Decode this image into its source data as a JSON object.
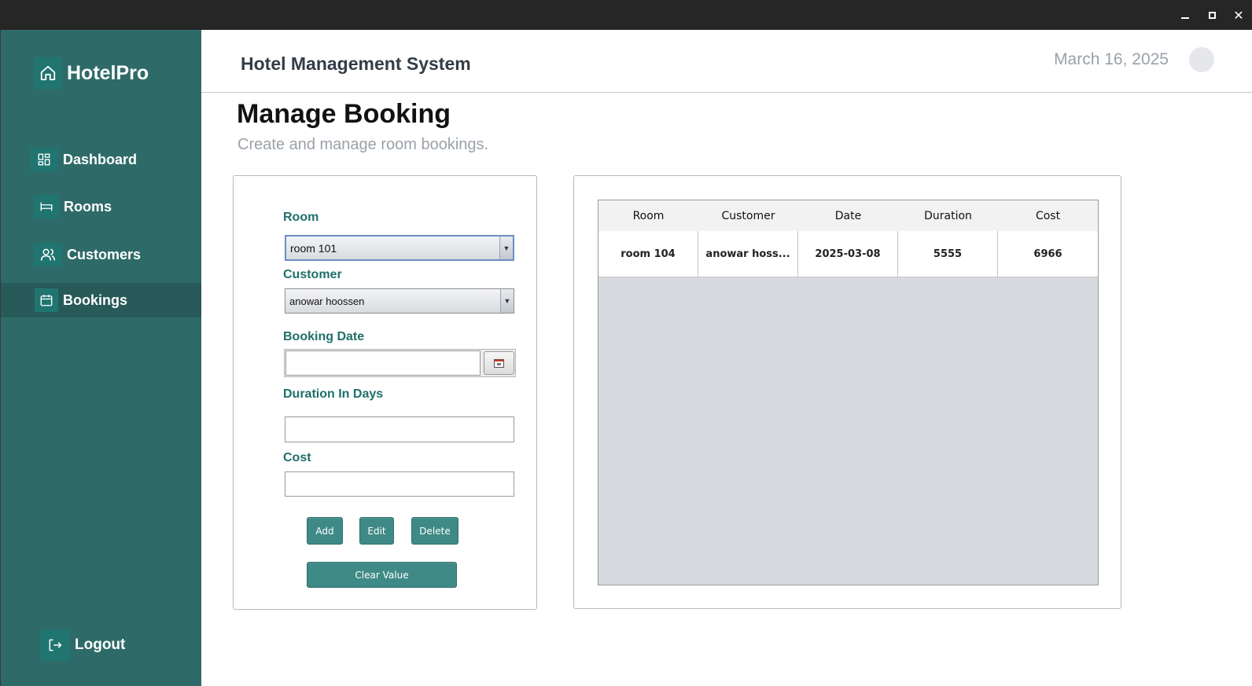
{
  "window": {
    "close_glyph": "✕"
  },
  "sidebar": {
    "brand": "HotelPro",
    "items": [
      {
        "label": "Dashboard",
        "icon": "dashboard-icon",
        "active": false
      },
      {
        "label": "Rooms",
        "icon": "bed-icon",
        "active": false
      },
      {
        "label": "Customers",
        "icon": "users-icon",
        "active": false
      },
      {
        "label": "Bookings",
        "icon": "calendar-icon",
        "active": true
      }
    ],
    "logout": "Logout"
  },
  "header": {
    "title": "Hotel Management System",
    "date": "March 16, 2025"
  },
  "page": {
    "title": "Manage Booking",
    "subtitle": "Create and manage room bookings."
  },
  "form": {
    "room_label": "Room",
    "room_value": "room 101",
    "customer_label": "Customer",
    "customer_value": "anowar hoossen",
    "booking_date_label": "Booking Date",
    "booking_date_value": "",
    "duration_label": "Duration In Days",
    "duration_value": "",
    "cost_label": "Cost",
    "cost_value": "",
    "add_label": "Add",
    "edit_label": "Edit",
    "delete_label": "Delete",
    "clear_label": "Clear Value"
  },
  "table": {
    "columns": [
      "Room",
      "Customer",
      "Date",
      "Duration",
      "Cost"
    ],
    "rows": [
      [
        "room 104",
        "anowar hoss...",
        "2025-03-08",
        "5555",
        "6966"
      ]
    ]
  },
  "colors": {
    "sidebar": "#2e6b68",
    "sidebar_active": "#275a58",
    "accent": "#1f6f6b",
    "button": "#3f8a86"
  }
}
